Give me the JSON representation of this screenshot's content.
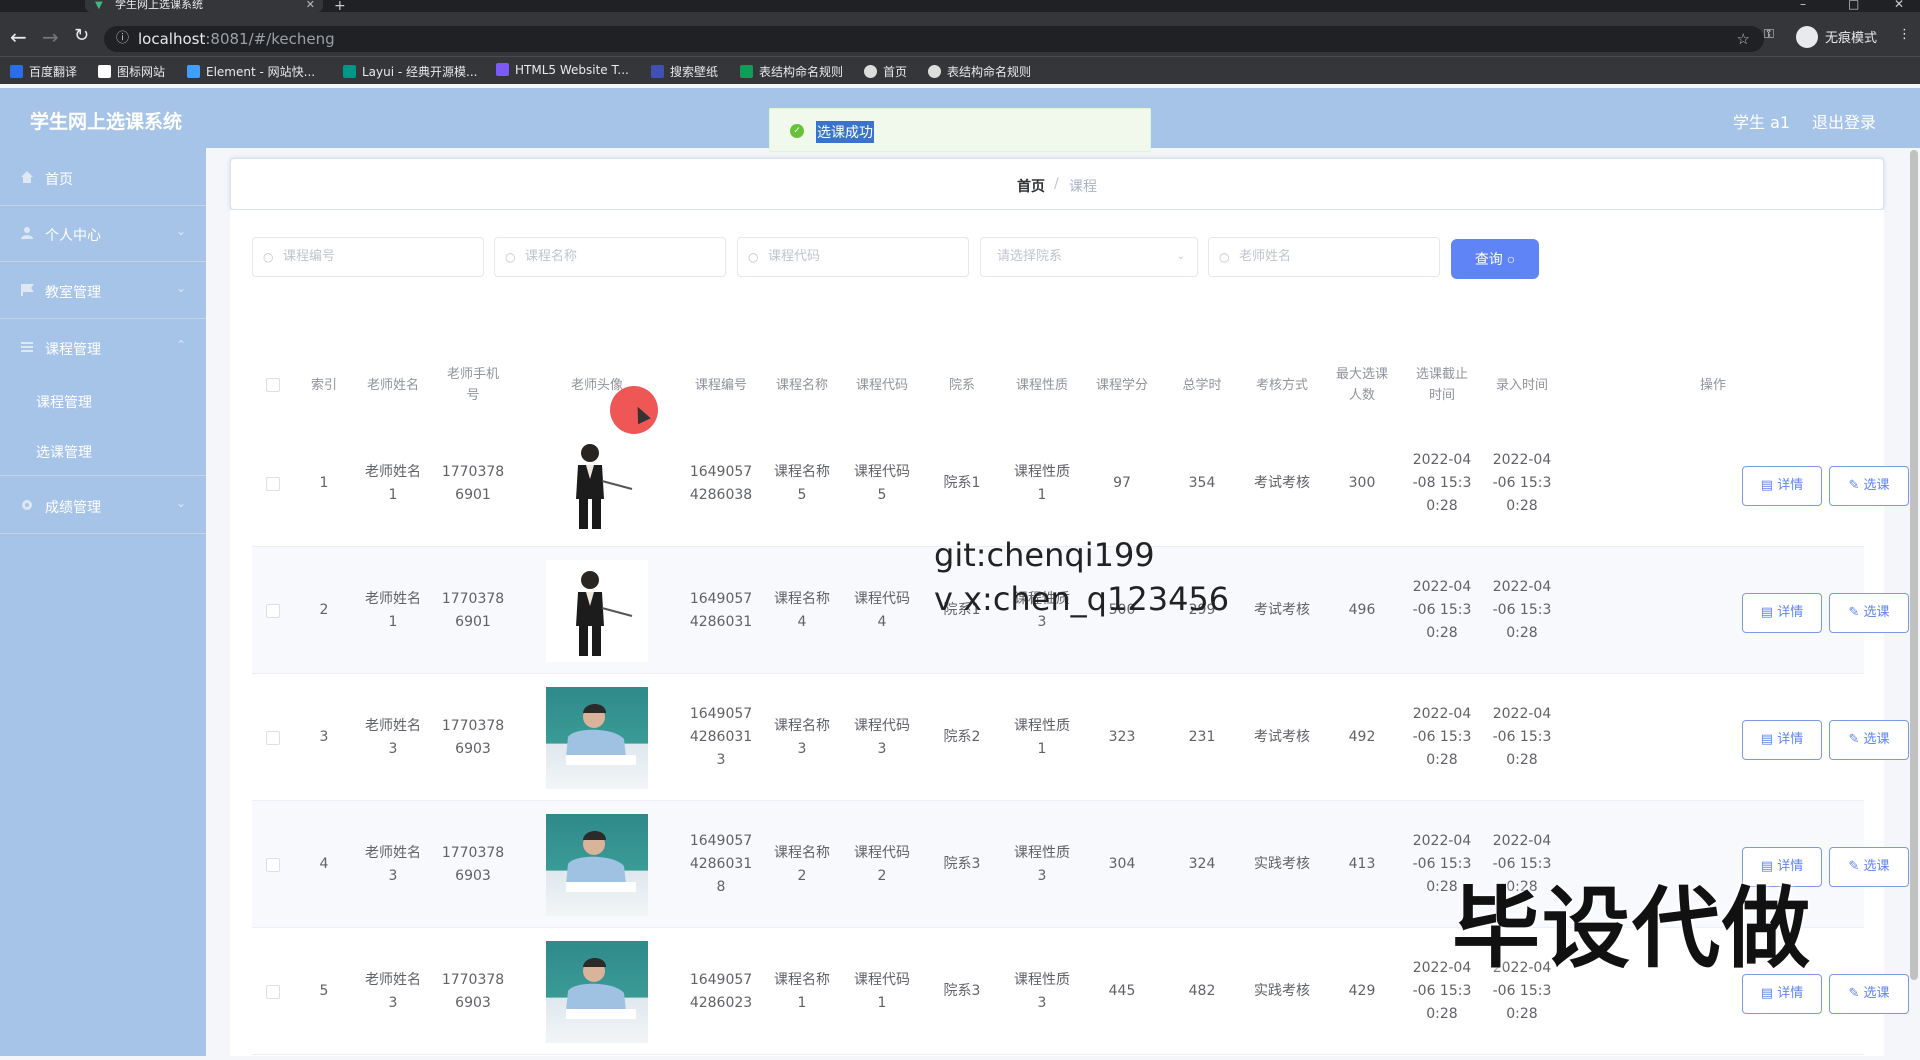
{
  "browser": {
    "tab_title": "学生网上选课系统",
    "url_host": "localhost",
    "url_path": ":8081/#/kecheng",
    "incognito_label": "无痕模式",
    "bookmarks": [
      {
        "label": "百度翻译",
        "color": "#2b6de8"
      },
      {
        "label": "图标网站",
        "color": "#ffffff"
      },
      {
        "label": "Element - 网站快...",
        "color": "#409eff"
      },
      {
        "label": "Layui - 经典开源模...",
        "color": "#009688"
      },
      {
        "label": "HTML5 Website T...",
        "color": "#7a5af8"
      },
      {
        "label": "搜索壁纸",
        "color": "#3f51b5"
      },
      {
        "label": "表结构命名规则",
        "color": "#0f9d58"
      },
      {
        "label": "首页",
        "color": "#dddddd"
      },
      {
        "label": "表结构命名规则",
        "color": "#dddddd"
      }
    ]
  },
  "header": {
    "title": "学生网上选课系统",
    "user": "学生 a1",
    "logout": "退出登录"
  },
  "toast": {
    "message": "选课成功"
  },
  "sidebar": {
    "items": [
      {
        "label": "首页",
        "icon": "home-icon"
      },
      {
        "label": "个人中心",
        "icon": "user-icon"
      },
      {
        "label": "教室管理",
        "icon": "flag-icon"
      },
      {
        "label": "课程管理",
        "icon": "list-icon"
      },
      {
        "label": "成绩管理",
        "icon": "gear-icon"
      }
    ],
    "submenu": [
      "课程管理",
      "选课管理"
    ]
  },
  "breadcrumb": {
    "home": "首页",
    "sep": "/",
    "current": "课程"
  },
  "search": {
    "course_no_ph": "课程编号",
    "course_name_ph": "课程名称",
    "course_code_ph": "课程代码",
    "dept_ph": "请选择院系",
    "teacher_ph": "老师姓名",
    "query_label": "查询"
  },
  "table": {
    "headers": {
      "index": "索引",
      "teacher_name": "老师姓名",
      "teacher_phone": "老师手机\n号",
      "teacher_photo": "老师头像",
      "course_no": "课程编号",
      "course_name": "课程名称",
      "course_code": "课程代码",
      "dept": "院系",
      "nature": "课程性质",
      "credit": "课程学分",
      "hours": "总学时",
      "exam": "考核方式",
      "max": "最大选课\n人数",
      "deadline": "选课截止\n时间",
      "created": "录入时间",
      "ops": "操作"
    },
    "rows": [
      {
        "index": "1",
        "teacher_name": "老师姓名\n1",
        "teacher_phone": "1770378\n6901",
        "photo": "woman",
        "course_no": "1649057\n4286038",
        "course_name": "课程名称\n5",
        "course_code": "课程代码\n5",
        "dept": "院系1",
        "nature": "课程性质\n1",
        "credit": "97",
        "hours": "354",
        "exam": "考试考核",
        "max": "300",
        "deadline": "2022-04\n-08 15:3\n0:28",
        "created": "2022-04\n-06 15:3\n0:28"
      },
      {
        "index": "2",
        "teacher_name": "老师姓名\n1",
        "teacher_phone": "1770378\n6901",
        "photo": "woman",
        "course_no": "1649057\n4286031",
        "course_name": "课程名称\n4",
        "course_code": "课程代码\n4",
        "dept": "院系1",
        "nature": "课程性质\n3",
        "credit": "500",
        "hours": "299",
        "exam": "考试考核",
        "max": "496",
        "deadline": "2022-04\n-06 15:3\n0:28",
        "created": "2022-04\n-06 15:3\n0:28"
      },
      {
        "index": "3",
        "teacher_name": "老师姓名\n3",
        "teacher_phone": "1770378\n6903",
        "photo": "man",
        "course_no": "1649057\n4286031\n3",
        "course_name": "课程名称\n3",
        "course_code": "课程代码\n3",
        "dept": "院系2",
        "nature": "课程性质\n1",
        "credit": "323",
        "hours": "231",
        "exam": "考试考核",
        "max": "492",
        "deadline": "2022-04\n-06 15:3\n0:28",
        "created": "2022-04\n-06 15:3\n0:28"
      },
      {
        "index": "4",
        "teacher_name": "老师姓名\n3",
        "teacher_phone": "1770378\n6903",
        "photo": "man",
        "course_no": "1649057\n4286031\n8",
        "course_name": "课程名称\n2",
        "course_code": "课程代码\n2",
        "dept": "院系3",
        "nature": "课程性质\n3",
        "credit": "304",
        "hours": "324",
        "exam": "实践考核",
        "max": "413",
        "deadline": "2022-04\n-06 15:3\n0:28",
        "created": "2022-04\n-06 15:3\n0:28"
      },
      {
        "index": "5",
        "teacher_name": "老师姓名\n3",
        "teacher_phone": "1770378\n6903",
        "photo": "man",
        "course_no": "1649057\n4286023",
        "course_name": "课程名称\n1",
        "course_code": "课程代码\n1",
        "dept": "院系3",
        "nature": "课程性质\n3",
        "credit": "445",
        "hours": "482",
        "exam": "实践考核",
        "max": "429",
        "deadline": "2022-04\n-06 15:3\n0:28",
        "created": "2022-04\n-06 15:3\n0:28"
      }
    ],
    "detail_label": "详情",
    "select_label": "选课"
  },
  "overlays": {
    "line1": "git:chenqi199",
    "line2": "v x:chen_q123456",
    "big": "毕设代做"
  },
  "colors": {
    "header_bg": "#a6c3e8",
    "primary": "#5e84f5",
    "success": "#67c23a"
  }
}
